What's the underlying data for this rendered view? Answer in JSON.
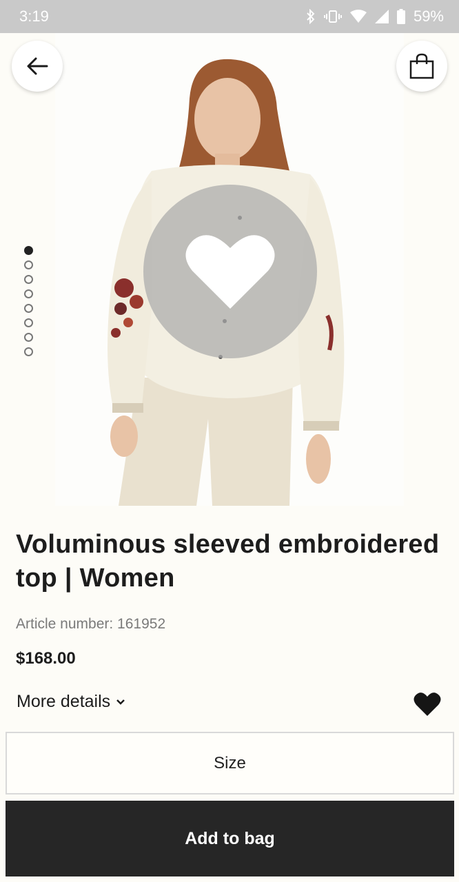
{
  "status_bar": {
    "time": "3:19",
    "battery": "59%",
    "icons": [
      "bluetooth-icon",
      "vibrate-icon",
      "wifi-icon",
      "signal-icon",
      "battery-icon"
    ]
  },
  "hero": {
    "image_description_icon": "product-photo",
    "pager": {
      "count": 8,
      "active_index": 0
    }
  },
  "product": {
    "title": "Voluminous sleeved embroidered top | Women",
    "article_number": "Article number: 161952",
    "price": "$168.00",
    "more_details": "More details"
  },
  "actions": {
    "size": "Size",
    "add_to_bag": "Add to bag"
  },
  "colors": {
    "background": "#fdfcf7",
    "status_bar": "#c9c9c9",
    "primary_button": "#262626",
    "blouse": "#f3efe2",
    "trousers": "#e9e1cf",
    "embroidery": "#8a2f2c"
  }
}
